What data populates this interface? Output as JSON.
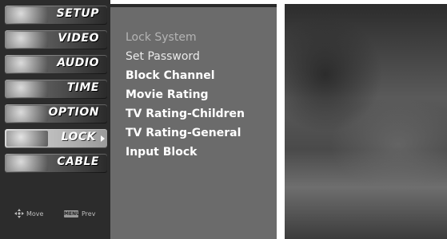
{
  "main_menu": {
    "items": [
      {
        "label": "SETUP",
        "icon": "setup-icon"
      },
      {
        "label": "VIDEO",
        "icon": "video-icon"
      },
      {
        "label": "AUDIO",
        "icon": "audio-icon"
      },
      {
        "label": "TIME",
        "icon": "time-icon"
      },
      {
        "label": "OPTION",
        "icon": "option-icon"
      },
      {
        "label": "LOCK",
        "icon": "lock-icon",
        "selected": true
      },
      {
        "label": "CABLE",
        "icon": "cable-icon"
      }
    ],
    "hints": {
      "move_label": "Move",
      "prev_key": "MENU",
      "prev_label": "Prev"
    }
  },
  "lock_submenu": {
    "items": [
      {
        "label": "Lock System",
        "state": "disabled"
      },
      {
        "label": "Set Password",
        "state": "normal"
      },
      {
        "label": "Block Channel",
        "state": "active"
      },
      {
        "label": "Movie Rating",
        "state": "active"
      },
      {
        "label": "TV Rating-Children",
        "state": "active"
      },
      {
        "label": "TV Rating-General",
        "state": "active"
      },
      {
        "label": "Input Block",
        "state": "active"
      }
    ]
  },
  "colors": {
    "menu_background": "#2c2c2c",
    "submenu_background": "#6b6b6b",
    "selected_tab": "#bdbdbd"
  }
}
